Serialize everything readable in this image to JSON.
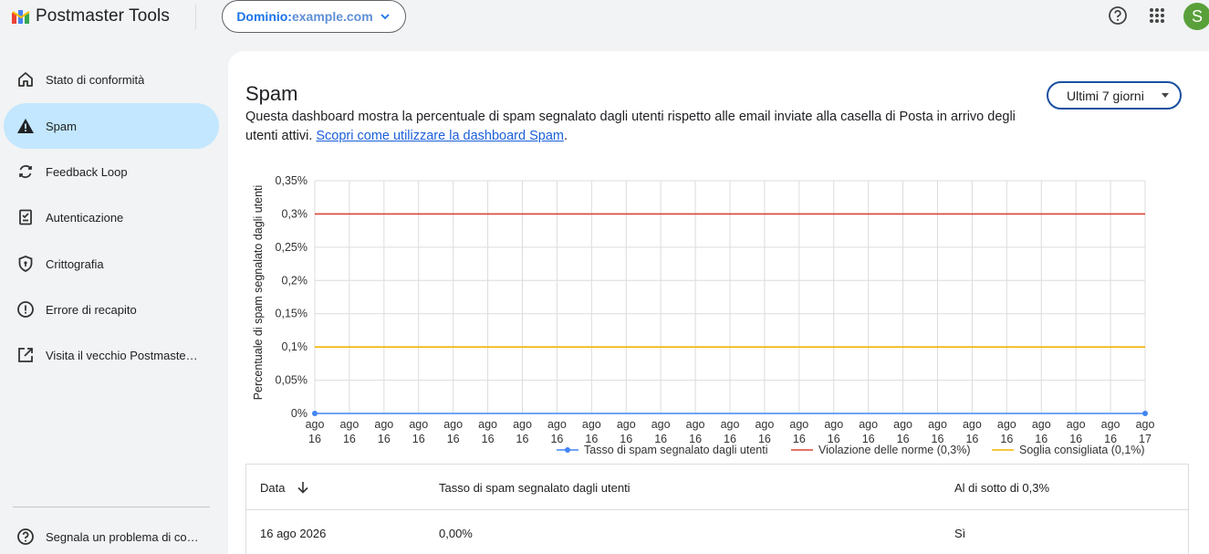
{
  "header": {
    "app_title": "Postmaster Tools",
    "domain_label": "Dominio:",
    "domain_value": "example.com",
    "avatar_letter": "S"
  },
  "sidebar": {
    "items": [
      {
        "label": "Stato di conformità",
        "icon": "home-icon"
      },
      {
        "label": "Spam",
        "icon": "warning-icon",
        "active": true
      },
      {
        "label": "Feedback Loop",
        "icon": "sync-icon"
      },
      {
        "label": "Autenticazione",
        "icon": "checklist-icon"
      },
      {
        "label": "Crittografia",
        "icon": "shield-icon"
      },
      {
        "label": "Errore di recapito",
        "icon": "error-icon"
      },
      {
        "label": "Visita il vecchio Postmaste…",
        "icon": "open-in-new-icon"
      }
    ],
    "footer_item": {
      "label": "Segnala un problema di co…",
      "icon": "help-icon"
    }
  },
  "main": {
    "title": "Spam",
    "description": "Questa dashboard mostra la percentuale di spam segnalato dagli utenti rispetto alle email inviate alla casella di Posta in arrivo degli utenti attivi. ",
    "link_text": "Scopri come utilizzare la dashboard Spam",
    "description_end": ".",
    "period_button": "Ultimi 7 giorni"
  },
  "chart_data": {
    "type": "line",
    "ylabel": "Percentuale di spam segnalato dagli utenti",
    "y_ticks": [
      "0%",
      "0,05%",
      "0,1%",
      "0,15%",
      "0,2%",
      "0,25%",
      "0,3%",
      "0,35%"
    ],
    "ylim": [
      0,
      0.35
    ],
    "x_labels": [
      "ago 16",
      "ago 16",
      "ago 16",
      "ago 16",
      "ago 16",
      "ago 16",
      "ago 16",
      "ago 16",
      "ago 16",
      "ago 16",
      "ago 16",
      "ago 16",
      "ago 16",
      "ago 16",
      "ago 16",
      "ago 16",
      "ago 16",
      "ago 16",
      "ago 16",
      "ago 16",
      "ago 16",
      "ago 16",
      "ago 16",
      "ago 16",
      "ago 17"
    ],
    "grid": true,
    "legend_position": "bottom-right",
    "series": [
      {
        "name": "Tasso di spam segnalato dagli utenti",
        "color": "#4285f4",
        "values": [
          0,
          0
        ],
        "points_at": [
          0,
          24
        ]
      },
      {
        "name": "Violazione delle norme (0,3%)",
        "color": "#db4437",
        "values": [
          0.3,
          0.3
        ],
        "points_at": [
          0,
          24
        ]
      },
      {
        "name": "Soglia consigliata (0,1%)",
        "color": "#f4b400",
        "values": [
          0.1,
          0.1
        ],
        "points_at": [
          0,
          24
        ]
      }
    ]
  },
  "table": {
    "headers": [
      "Data",
      "Tasso di spam segnalato dagli utenti",
      "Al di sotto di 0,3%"
    ],
    "rows": [
      [
        "16 ago 2026",
        "0,00%",
        "Sì"
      ]
    ]
  }
}
